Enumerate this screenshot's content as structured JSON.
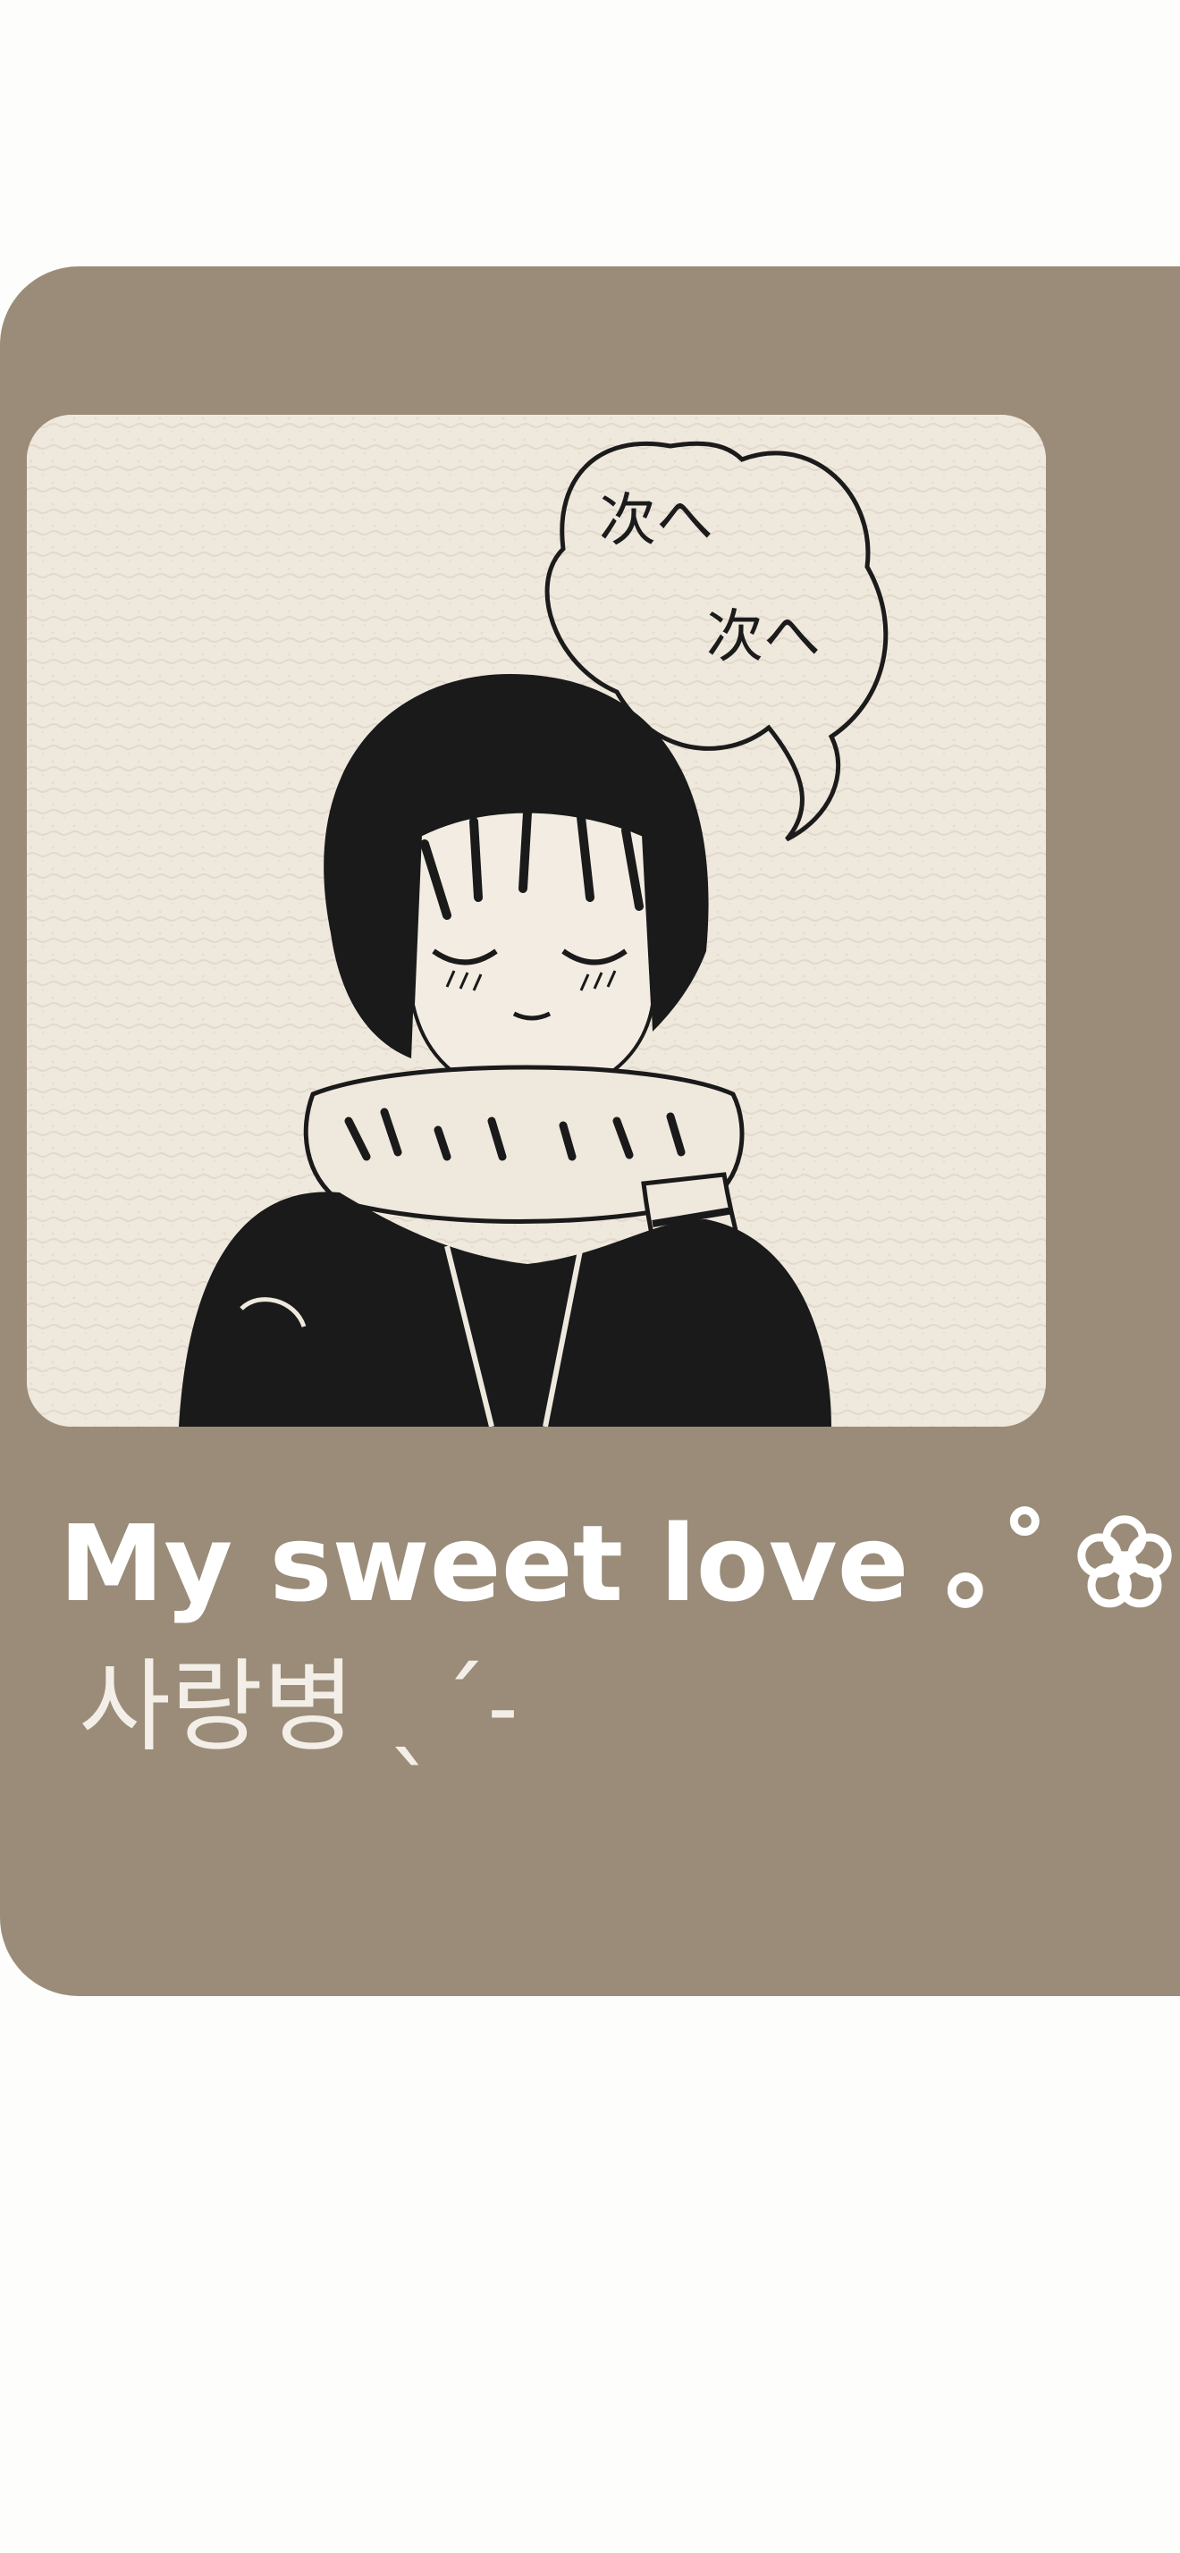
{
  "widget": {
    "title": "My sweet love ｡˚",
    "subtitle": "사랑병 ˎˊ˗",
    "flower_icon": "flower-icon",
    "speech_bubble_text": [
      "次へ",
      "次へ"
    ],
    "colors": {
      "page_background": "#fdfdfc",
      "card_background": "#9a8c78",
      "artwork_paper": "#efe8dd",
      "title_text": "#ffffff"
    }
  }
}
